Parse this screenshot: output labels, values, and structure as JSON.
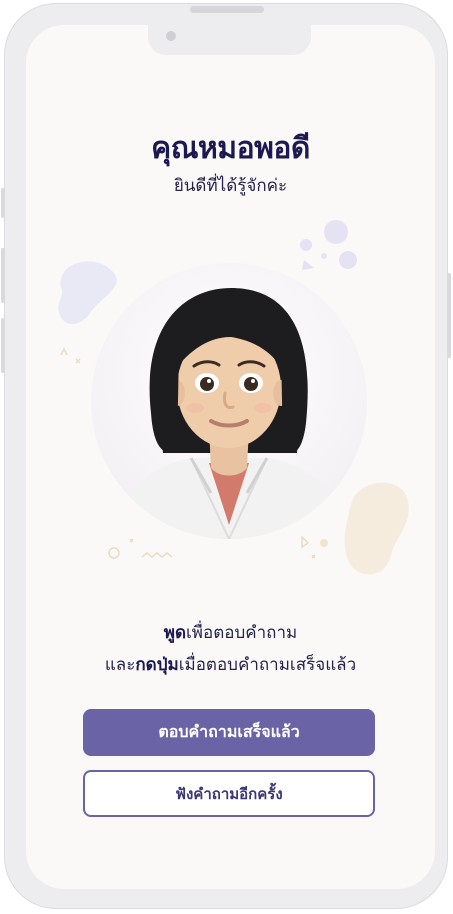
{
  "header": {
    "title": "คุณหมอพอดี",
    "subtitle": "ยินดีที่ได้รู้จักค่ะ"
  },
  "avatar": {
    "description_icon": "doctor-avatar"
  },
  "instructions": {
    "line1_bold": "พูด",
    "line1_rest": "เพื่อตอบคำถาม",
    "line2_prefix": "และ",
    "line2_bold": "กดปุ่ม",
    "line2_rest": "เมื่อตอบคำถามเสร็จแล้ว"
  },
  "actions": {
    "done_label": "ตอบคำถามเสร็จแล้ว",
    "replay_label": "ฟังคำถามอีกครั้ง"
  },
  "colors": {
    "primary": "#6a64a6",
    "title": "#1c1850",
    "background": "#faf9f7"
  }
}
